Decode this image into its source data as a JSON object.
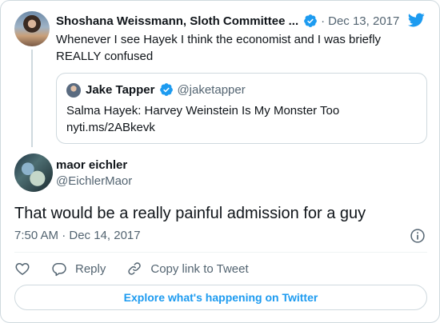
{
  "parent_tweet": {
    "name": "Shoshana Weissmann, Sloth Committee ...",
    "date": "Dec 13, 2017",
    "separator": "·",
    "text": "Whenever I see Hayek I think the economist and I was briefly REALLY confused",
    "quoted": {
      "name": "Jake Tapper",
      "handle": "@jaketapper",
      "text_line1": "Salma Hayek: Harvey Weinstein Is My Monster Too",
      "text_line2": "nyti.ms/2ABkevk"
    }
  },
  "main_tweet": {
    "name": "maor eichler",
    "handle": "@EichlerMaor",
    "text": "That would be a really painful admission for a guy",
    "meta": "7:50 AM · Dec 14, 2017"
  },
  "actions": {
    "reply_label": "Reply",
    "copy_link_label": "Copy link to Tweet"
  },
  "explore_label": "Explore what's happening on Twitter",
  "colors": {
    "accent": "#1d9bf0",
    "text": "#0f1419",
    "muted": "#536471",
    "border": "#cfd9de"
  },
  "icons": [
    "verified-badge-icon",
    "twitter-bird-icon",
    "info-icon",
    "heart-icon",
    "reply-icon",
    "link-icon"
  ]
}
